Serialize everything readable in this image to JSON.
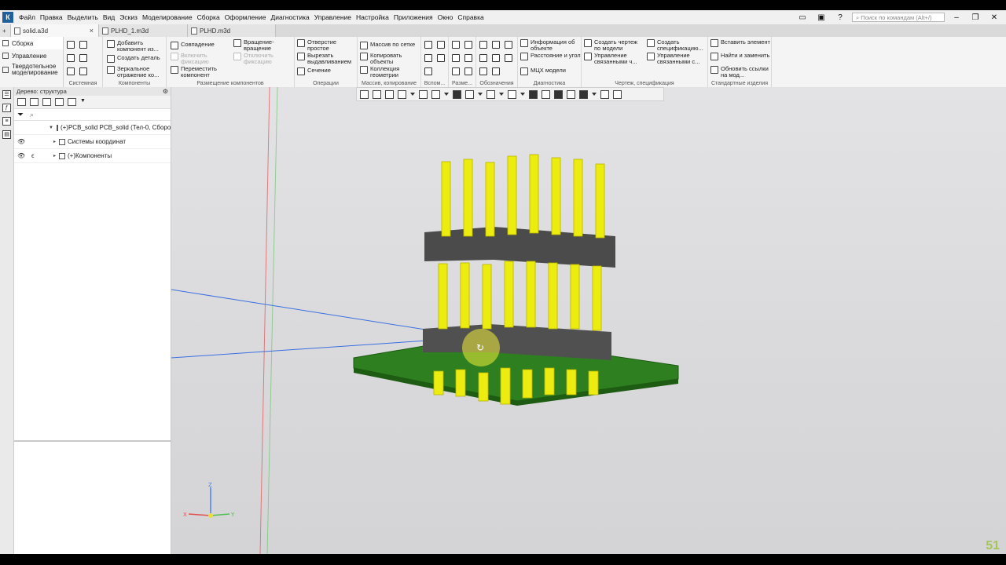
{
  "menu": {
    "items": [
      "Файл",
      "Правка",
      "Выделить",
      "Вид",
      "Эскиз",
      "Моделирование",
      "Сборка",
      "Оформление",
      "Диагностика",
      "Управление",
      "Настройка",
      "Приложения",
      "Окно",
      "Справка"
    ],
    "search_placeholder": "Поиск по командам (Alt+/)"
  },
  "tabs": [
    {
      "label": "solid.a3d",
      "active": true,
      "close": "×"
    },
    {
      "label": "PLHD_1.m3d",
      "active": false
    },
    {
      "label": "PLHD.m3d",
      "active": false
    }
  ],
  "ribbon": {
    "side_tabs": [
      "Сборка",
      "Управление",
      "Твердотельное моделирование"
    ],
    "groups": {
      "sistemnaya": "Системная",
      "komponenty": "Компоненты",
      "razmeshchenie": "Размещение компонентов",
      "operatsii": "Операции",
      "massiv": "Массив, копирование",
      "vspom": "Вспом...",
      "razme": "Разме...",
      "oboznacheniya": "Обозначения",
      "diagnostika": "Диагностика",
      "chertezh": "Чертеж, спецификация",
      "standartnye": "Стандартные изделия"
    },
    "buttons": {
      "add_component": "Добавить компонент из...",
      "create_part": "Создать деталь",
      "mirror_component": "Зеркальное отражение ко...",
      "coincidence": "Совпадение",
      "enable_fix": "Включить фиксацию",
      "move_component": "Переместить компонент",
      "rotate": "Вращение-вращение",
      "disable_fix": "Отключить фиксацию",
      "hole_simple": "Отверстие простое",
      "cut_extrude": "Вырезать выдавливанием",
      "section": "Сечение",
      "grid_array": "Массив по сетке",
      "copy_objects": "Копировать объекты",
      "geometry_collection": "Коллекция геометрии",
      "mass_center": "МЦХ модели",
      "object_info": "Информация об объекте",
      "distance_angle": "Расстояние и угол",
      "create_drawing": "Создать чертеж по модели",
      "manage_linked": "Управление связанными ч...",
      "create_spec": "Создать спецификацию...",
      "manage_linked_spec": "Управление связанными с...",
      "insert_element": "Вставить элемент",
      "find_replace": "Найти и заменить",
      "update_links": "Обновить ссылки на мод..."
    }
  },
  "tree": {
    "header": "Дерево: структура",
    "search_icon": "search-icon",
    "rows": [
      {
        "label": "(+)PCB_solid PCB_solid (Тел-0, Сборо..."
      },
      {
        "label": "Системы координат"
      },
      {
        "label": "(+)Компоненты"
      }
    ]
  },
  "axes": {
    "x": "X",
    "y": "Y",
    "z": "Z"
  },
  "watermark": "51",
  "colors": {
    "board": "#2d7d1e",
    "pins": "#e8e200",
    "housing": "#4a4a4a",
    "viewport_bg": "#dcdcde"
  }
}
